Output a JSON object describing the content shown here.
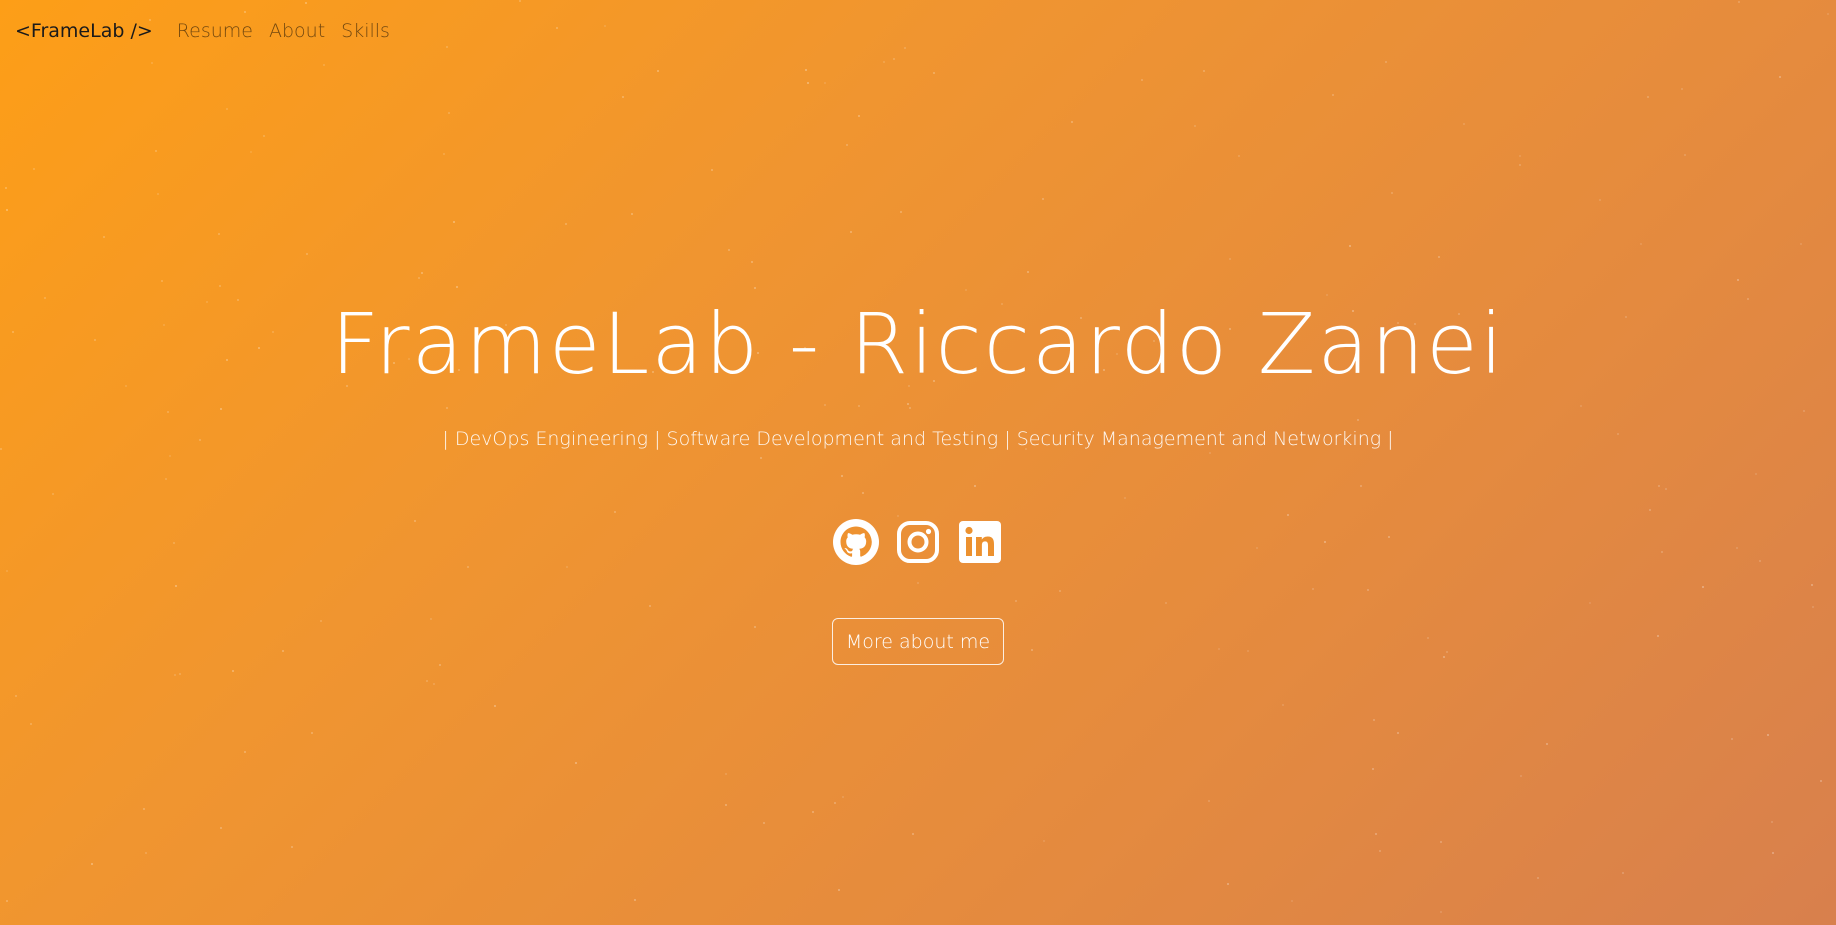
{
  "navbar": {
    "brand": "<FrameLab />",
    "links": [
      {
        "label": "Resume"
      },
      {
        "label": "About"
      },
      {
        "label": "Skills"
      }
    ]
  },
  "hero": {
    "title": "FrameLab - Riccardo Zanei",
    "subtitle": "| DevOps Engineering | Software Development and Testing | Security Management and Networking |",
    "socials": [
      {
        "icon": "github-icon"
      },
      {
        "icon": "instagram-icon"
      },
      {
        "icon": "linkedin-icon"
      }
    ],
    "cta_label": "More about me"
  },
  "colors": {
    "gradient_start": "#fd9e17",
    "gradient_end": "#d8804d",
    "text": "#ffffff",
    "brand_text": "#1a1a1a"
  }
}
